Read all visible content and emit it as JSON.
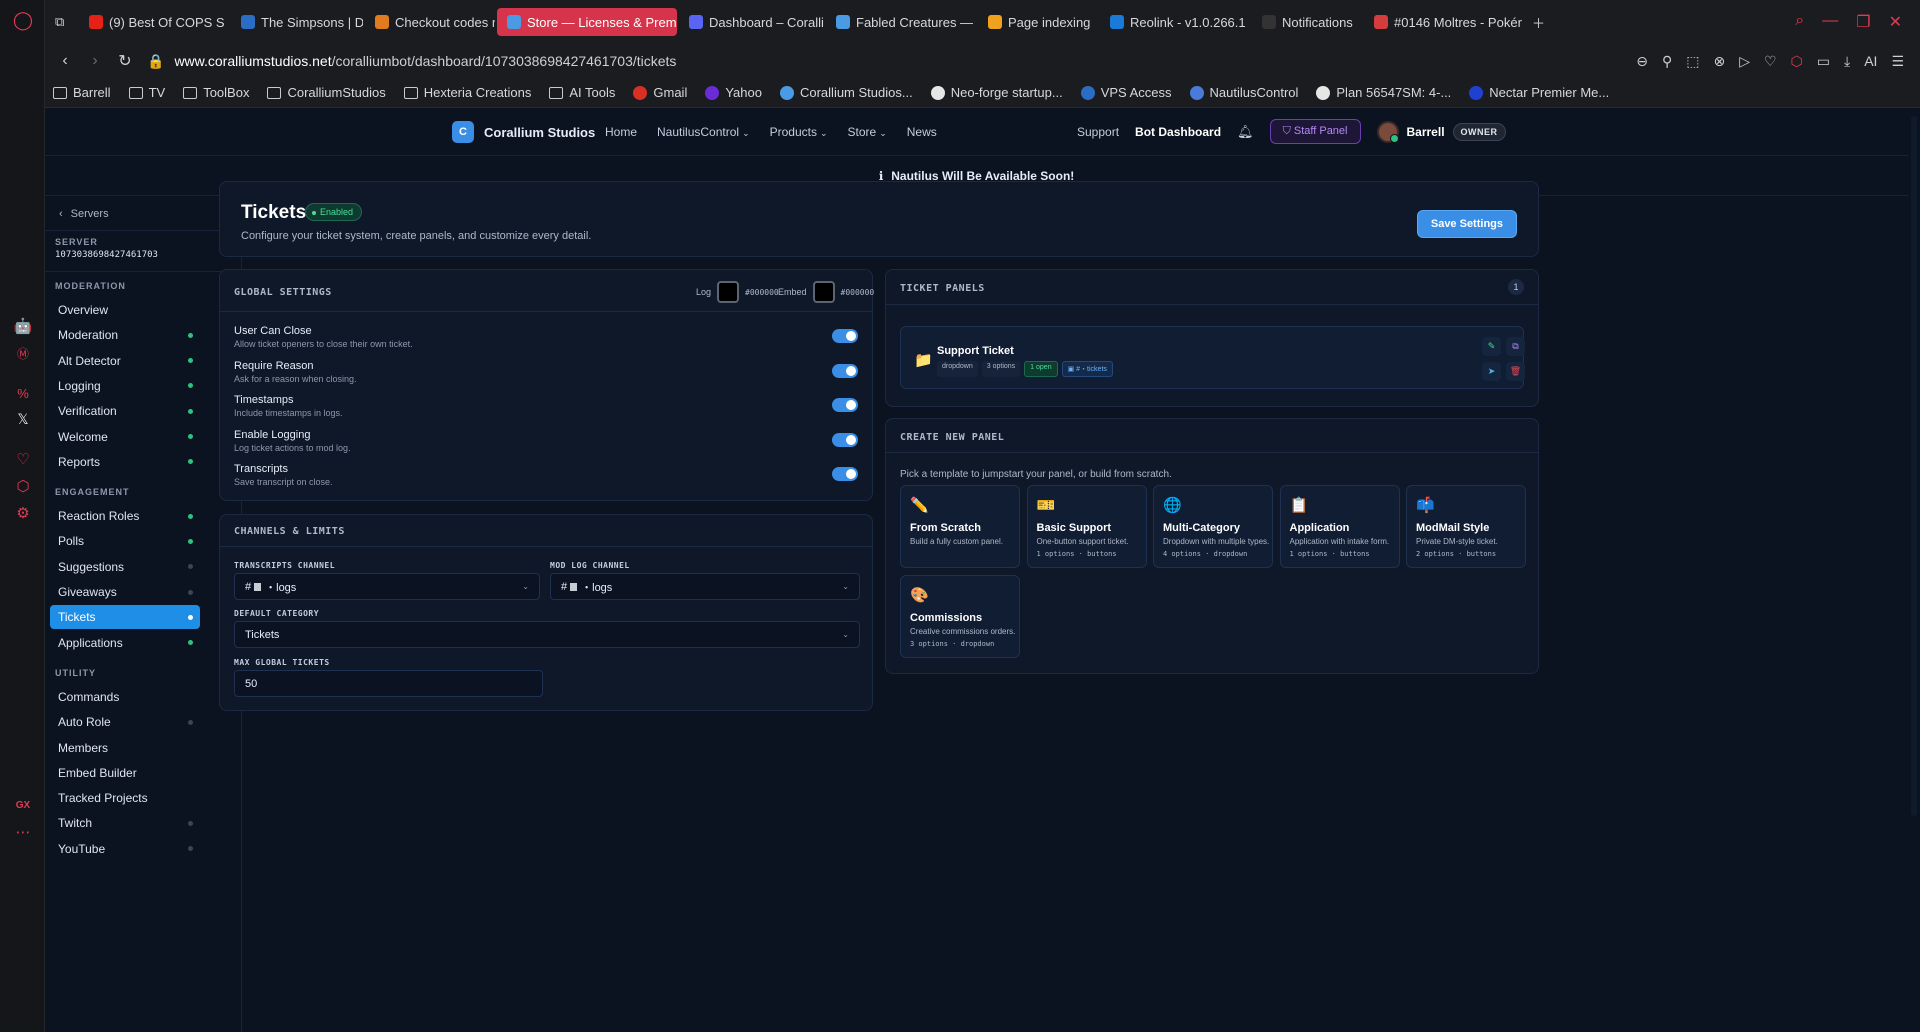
{
  "browser": {
    "tabs": [
      {
        "label": "(9) Best Of COPS S",
        "icon": "youtube-icon",
        "color": "#e62117"
      },
      {
        "label": "The Simpsons | Disne",
        "icon": "disney-icon",
        "color": "#2b6cc4"
      },
      {
        "label": "Checkout codes not g",
        "icon": "sun-icon",
        "color": "#e07b1f"
      },
      {
        "label": "Store — Licenses & Premiu",
        "icon": "globe-icon",
        "color": "#4a9be3",
        "active": true
      },
      {
        "label": "Dashboard – Coralliur",
        "icon": "discord-icon",
        "color": "#5865f2"
      },
      {
        "label": "Fabled Creatures — C",
        "icon": "globe-icon",
        "color": "#4a9be3"
      },
      {
        "label": "Page indexing",
        "icon": "analytics-icon",
        "color": "#f0a21c"
      },
      {
        "label": "Reolink - v1.0.266.1",
        "icon": "app-icon",
        "color": "#1a7ad9"
      },
      {
        "label": "Notifications",
        "icon": "github-icon",
        "color": "#333333"
      },
      {
        "label": "#0146 Moltres - Pokér",
        "icon": "pokedex-icon",
        "color": "#d53c3c"
      }
    ],
    "url_host": "www.coralliumstudios.net",
    "url_path": "/coralliumbot/dashboard/1073038698427461703/tickets",
    "ai_label": "AI",
    "bookmarks": [
      "Barrell",
      "TV",
      "ToolBox",
      "CoralliumStudios",
      "Hexteria Creations",
      "AI Tools",
      "Gmail",
      "Yahoo",
      "Corallium Studios...",
      "Neo-forge startup...",
      "VPS Access",
      "NautilusControl",
      "Plan 56547SM: 4-...",
      "Nectar Premier Me..."
    ],
    "gx_label": "GX"
  },
  "site": {
    "brand": "Corallium Studios",
    "brand_initial": "C",
    "nav": [
      "Home",
      "NautilusControl",
      "Products",
      "Store",
      "News"
    ],
    "support": "Support",
    "bot_dashboard": "Bot Dashboard",
    "staff_panel": "Staff Panel",
    "username": "Barrell",
    "role": "OWNER",
    "banner": "Nautilus Will Be Available Soon!",
    "colors": {
      "accent": "#3a8ee6",
      "active_item": "#1f8ee6",
      "online": "#2ec27e",
      "staff": "#b38af5"
    }
  },
  "sidebar": {
    "back": "Servers",
    "server_label": "SERVER",
    "server_id": "1073038698427461703",
    "sections": [
      {
        "title": "MODERATION",
        "items": [
          {
            "label": "Overview",
            "dot": "none"
          },
          {
            "label": "Moderation",
            "dot": "on"
          },
          {
            "label": "Alt Detector",
            "dot": "on"
          },
          {
            "label": "Logging",
            "dot": "on"
          },
          {
            "label": "Verification",
            "dot": "on"
          },
          {
            "label": "Welcome",
            "dot": "on"
          },
          {
            "label": "Reports",
            "dot": "on"
          }
        ]
      },
      {
        "title": "ENGAGEMENT",
        "items": [
          {
            "label": "Reaction Roles",
            "dot": "on"
          },
          {
            "label": "Polls",
            "dot": "on"
          },
          {
            "label": "Suggestions",
            "dot": "off"
          },
          {
            "label": "Giveaways",
            "dot": "off"
          },
          {
            "label": "Tickets",
            "dot": "on",
            "active": true
          },
          {
            "label": "Applications",
            "dot": "on"
          }
        ]
      },
      {
        "title": "UTILITY",
        "items": [
          {
            "label": "Commands",
            "dot": "none"
          },
          {
            "label": "Auto Role",
            "dot": "off"
          },
          {
            "label": "Members",
            "dot": "none"
          },
          {
            "label": "Embed Builder",
            "dot": "none"
          },
          {
            "label": "Tracked Projects",
            "dot": "none"
          },
          {
            "label": "Twitch",
            "dot": "off"
          },
          {
            "label": "YouTube",
            "dot": "off"
          }
        ]
      }
    ]
  },
  "header": {
    "title": "Tickets",
    "status": "Enabled",
    "description": "Configure your ticket system, create panels, and customize every detail.",
    "save": "Save Settings"
  },
  "global": {
    "title": "GLOBAL SETTINGS",
    "log_label": "Log",
    "log_color": "#000000",
    "embed_label": "Embed",
    "embed_color": "#000000",
    "settings": [
      {
        "name": "User Can Close",
        "desc": "Allow ticket openers to close their own ticket.",
        "on": true
      },
      {
        "name": "Require Reason",
        "desc": "Ask for a reason when closing.",
        "on": true
      },
      {
        "name": "Timestamps",
        "desc": "Include timestamps in logs.",
        "on": true
      },
      {
        "name": "Enable Logging",
        "desc": "Log ticket actions to mod log.",
        "on": true
      },
      {
        "name": "Transcripts",
        "desc": "Save transcript on close.",
        "on": true
      }
    ]
  },
  "channels": {
    "title": "CHANNELS & LIMITS",
    "transcripts_label": "TRANSCRIPTS CHANNEL",
    "transcripts_prefix": "#",
    "transcripts_value": "・logs",
    "modlog_label": "MOD LOG CHANNEL",
    "modlog_prefix": "#",
    "modlog_value": "・logs",
    "category_label": "DEFAULT CATEGORY",
    "category_value": "Tickets",
    "max_label": "MAX GLOBAL TICKETS",
    "max_value": "50"
  },
  "panels": {
    "title": "TICKET PANELS",
    "count": "1",
    "items": [
      {
        "name": "Support Ticket",
        "type": "dropdown",
        "options": "3 options",
        "open": "1 open",
        "channel": "#・tickets"
      }
    ]
  },
  "create": {
    "title": "CREATE NEW PANEL",
    "description": "Pick a template to jumpstart your panel, or build from scratch.",
    "templates": [
      {
        "name": "From Scratch",
        "desc": "Build a fully custom panel.",
        "meta": "",
        "icon": "pencil-icon",
        "glyph": "✏️"
      },
      {
        "name": "Basic Support",
        "desc": "One-button support ticket.",
        "meta": "1 options · buttons",
        "icon": "ticket-icon",
        "glyph": "🎫"
      },
      {
        "name": "Multi-Category",
        "desc": "Dropdown with multiple types.",
        "meta": "4 options · dropdown",
        "icon": "globe-icon",
        "glyph": "🌐"
      },
      {
        "name": "Application",
        "desc": "Application with intake form.",
        "meta": "1 options · buttons",
        "icon": "clipboard-icon",
        "glyph": "📋"
      },
      {
        "name": "ModMail Style",
        "desc": "Private DM-style ticket.",
        "meta": "2 options · buttons",
        "icon": "mailbox-icon",
        "glyph": "📫"
      },
      {
        "name": "Commissions",
        "desc": "Creative commissions orders.",
        "meta": "3 options · dropdown",
        "icon": "palette-icon",
        "glyph": "🎨"
      }
    ]
  }
}
